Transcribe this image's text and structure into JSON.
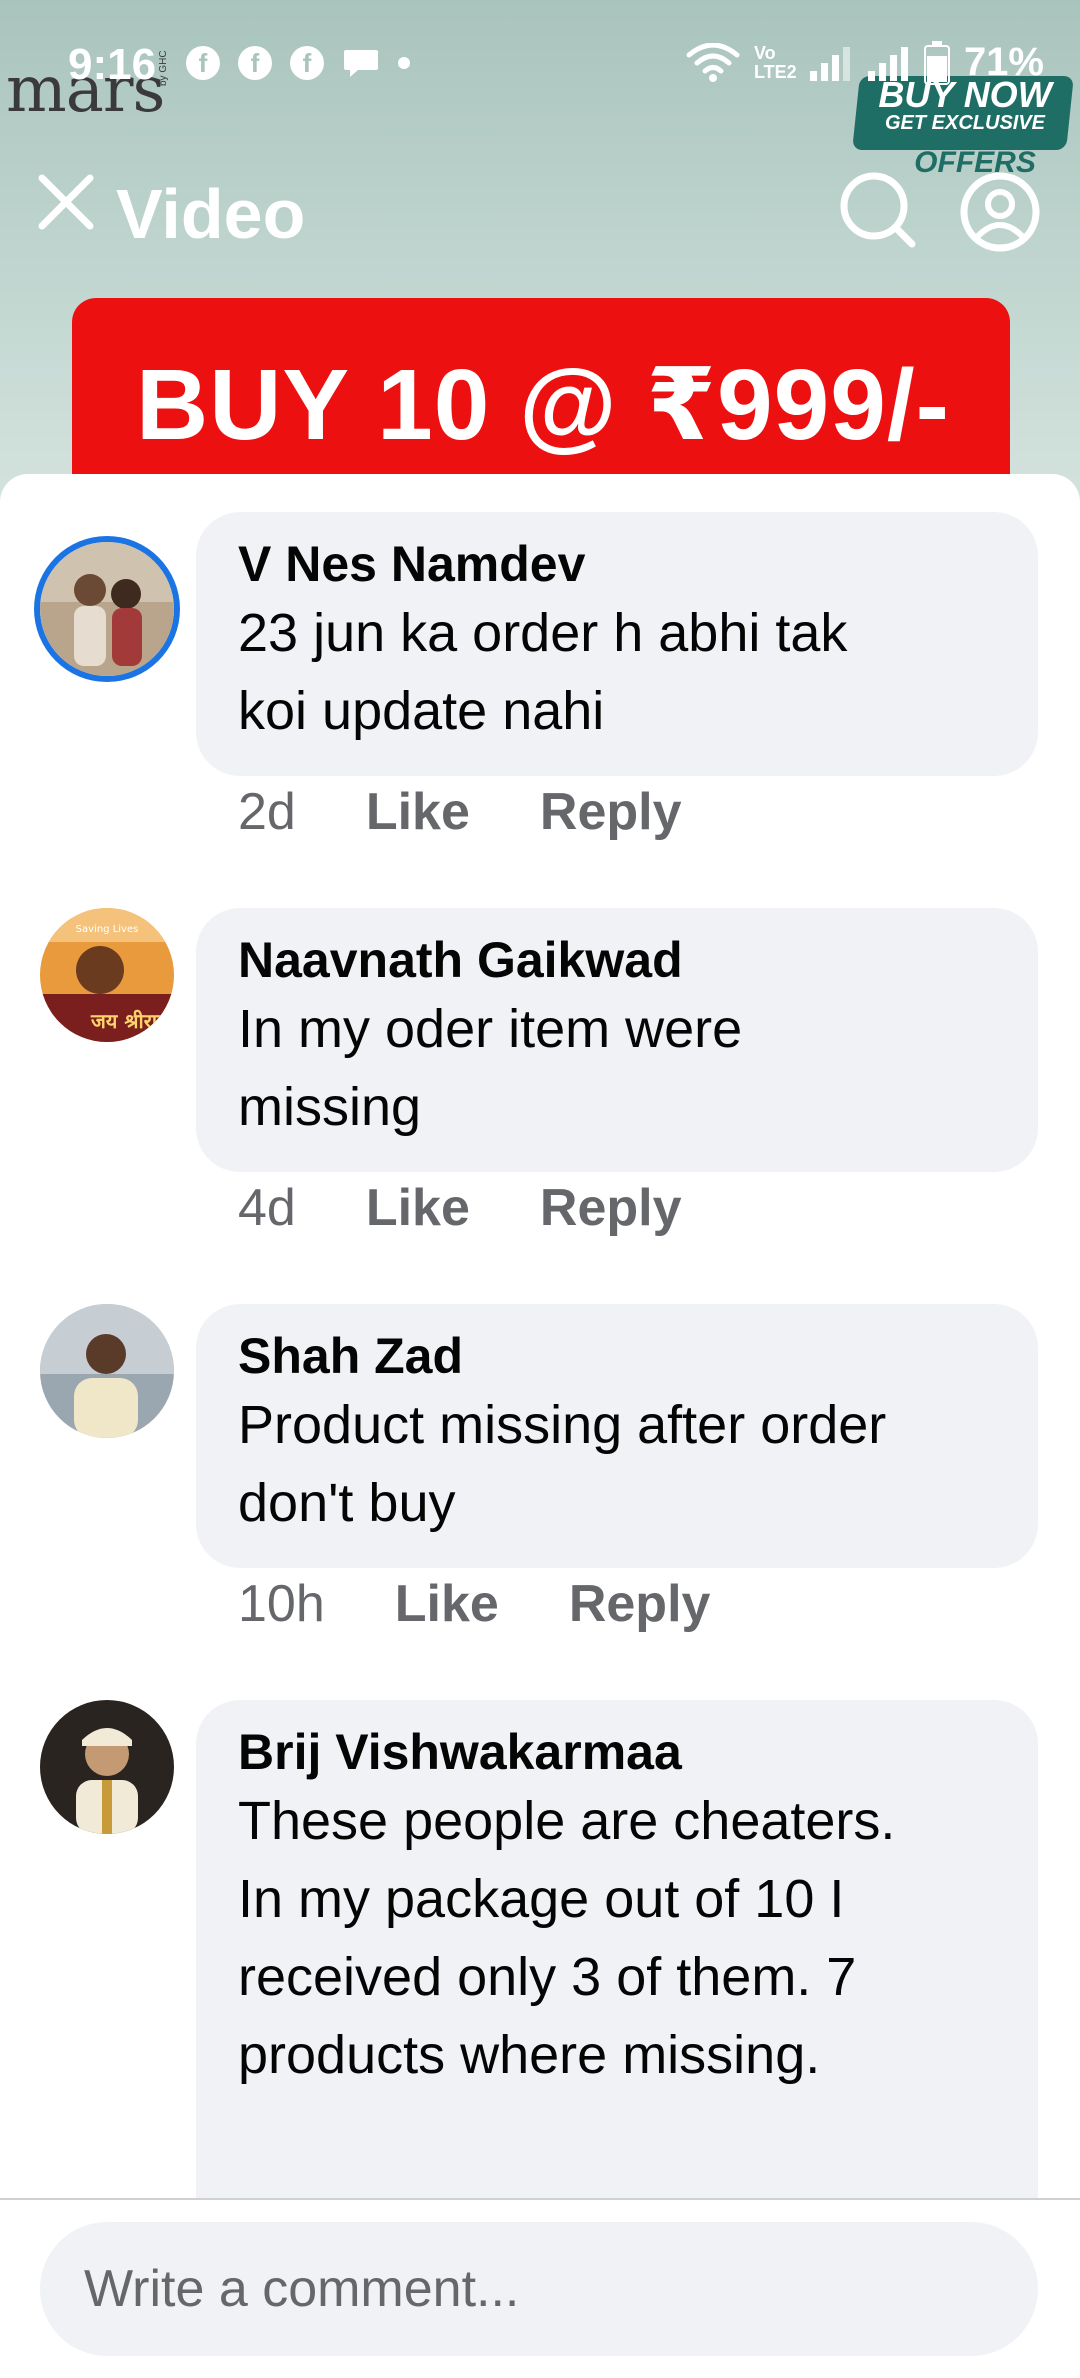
{
  "status_bar": {
    "time": "9:16",
    "notification_icons": [
      "facebook-icon",
      "facebook-icon",
      "facebook-icon",
      "chat-bubble-icon"
    ],
    "network_label": "Vo LTE2",
    "battery": "71%"
  },
  "background_video": {
    "brand": "mars",
    "brand_sub": "by GHC",
    "promo": {
      "line1": "BUY NOW",
      "line2": "GET EXCLUSIVE",
      "line3": "OFFERS"
    },
    "offer_text": "BUY 10 @  ₹999/-"
  },
  "nav": {
    "title": "Video"
  },
  "comments": [
    {
      "author": "V Nes Namdev",
      "text": "23 jun ka order h abhi tak\nkoi update nahi",
      "time": "2d",
      "like": "Like",
      "reply": "Reply"
    },
    {
      "author": "Naavnath Gaikwad",
      "text": "In my oder item were\nmissing",
      "time": "4d",
      "like": "Like",
      "reply": "Reply"
    },
    {
      "author": "Shah Zad",
      "text": "Product missing after order\ndon't buy",
      "time": "10h",
      "like": "Like",
      "reply": "Reply"
    },
    {
      "author": "Brij Vishwakarmaa",
      "text": "These people are cheaters.\nIn my package out of 10 I\nreceived only 3 of them. 7\nproducts where missing.",
      "time": "",
      "like": "",
      "reply": ""
    }
  ],
  "avatar_texts": {
    "saving_lives": "Saving Lives",
    "jay_shriram": "जय श्रीराम"
  },
  "composer": {
    "placeholder": "Write a comment..."
  },
  "colors": {
    "accent": "#1b74e4",
    "offer_red": "#ec1010",
    "bubble": "#f0f2f5",
    "muted": "#65676b"
  }
}
